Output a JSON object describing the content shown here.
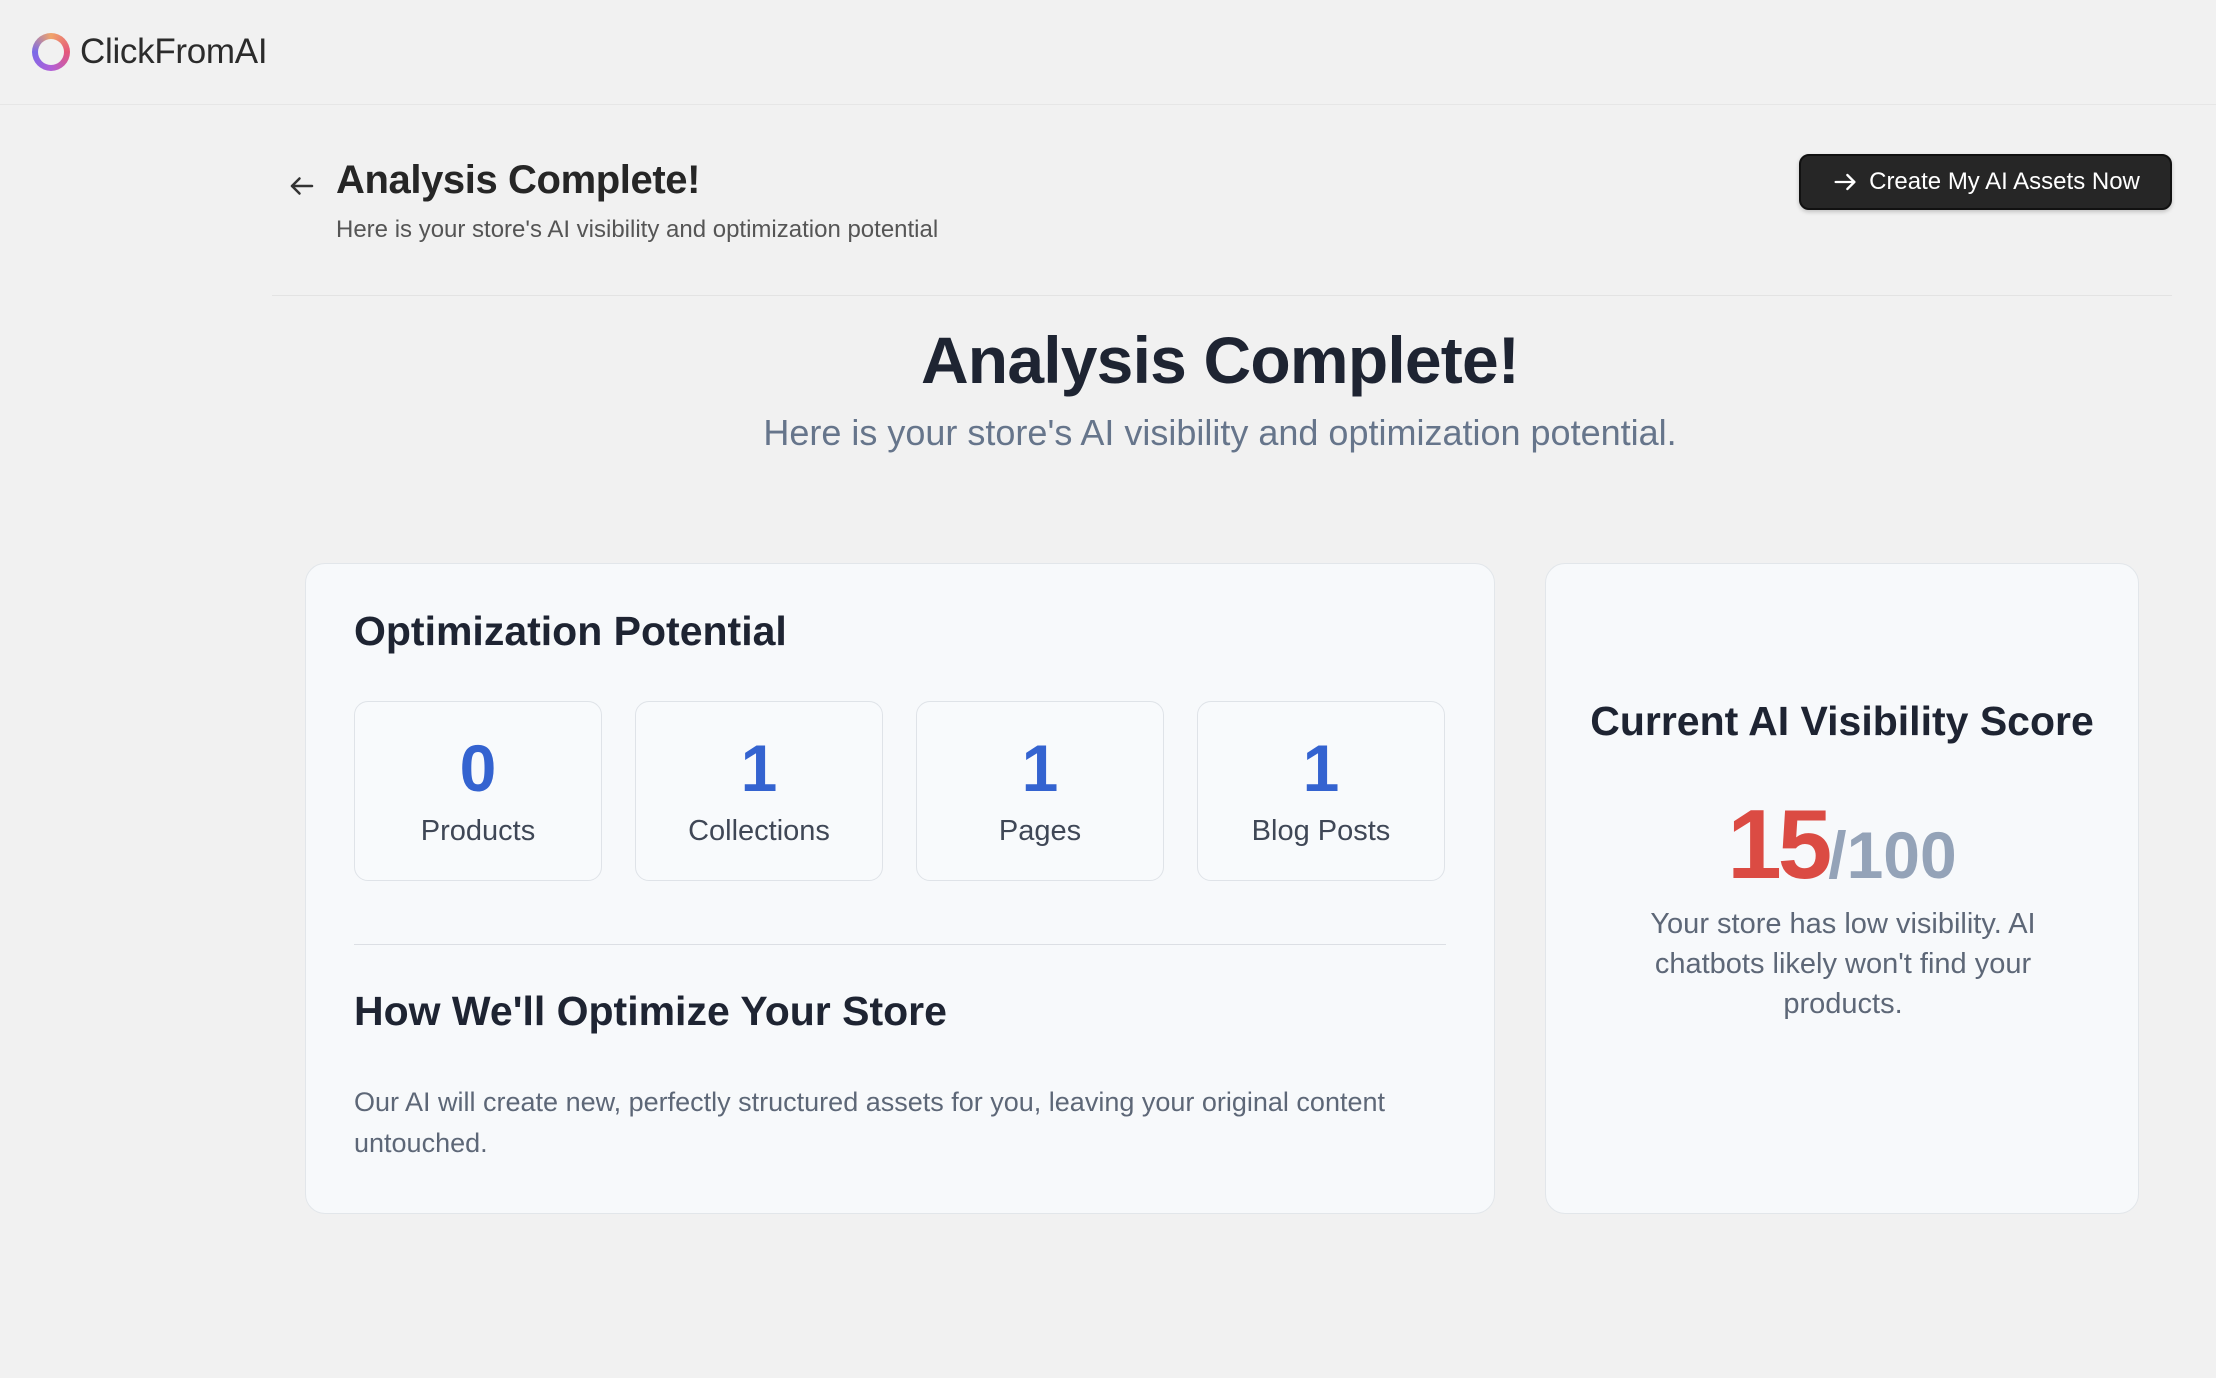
{
  "app": {
    "brand": "ClickFromAI",
    "logo_icon": "ring-logo-icon"
  },
  "header": {
    "title": "Analysis Complete!",
    "subtitle": "Here is your store's AI visibility and optimization potential",
    "cta_label": "Create My AI Assets Now",
    "cta_icon": "arrow-right-icon",
    "back_icon": "arrow-left-icon"
  },
  "hero": {
    "title": "Analysis Complete!",
    "subtitle": "Here is your store's AI visibility and optimization potential."
  },
  "optimization": {
    "title": "Optimization Potential",
    "stats": [
      {
        "value": "0",
        "label": "Products"
      },
      {
        "value": "1",
        "label": "Collections"
      },
      {
        "value": "1",
        "label": "Pages"
      },
      {
        "value": "1",
        "label": "Blog Posts"
      }
    ],
    "how_title": "How We'll Optimize Your Store",
    "how_desc": "Our AI will create new, perfectly structured assets for you, leaving your original content untouched."
  },
  "score": {
    "title": "Current AI Visibility Score",
    "value": "15",
    "max": "/100",
    "description": "Your store has low visibility. AI chatbots likely won't find your products.",
    "value_color": "#db4b43"
  },
  "colors": {
    "accent": "#3463d0",
    "cta_bg": "#262626"
  }
}
